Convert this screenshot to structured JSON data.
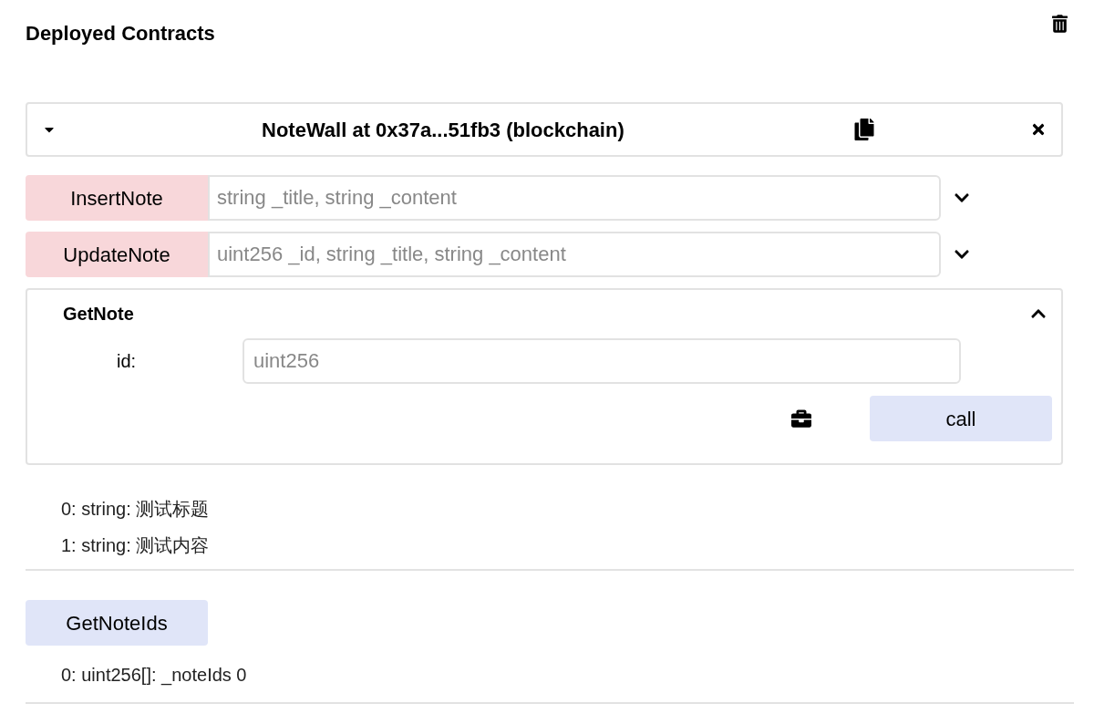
{
  "header": {
    "title": "Deployed Contracts"
  },
  "contract": {
    "title": "NoteWall at 0x37a...51fb3 (blockchain)",
    "expanded": true
  },
  "functions": [
    {
      "kind": "transact",
      "name": "InsertNote",
      "placeholder": "string _title, string _content",
      "expanded": false
    },
    {
      "kind": "transact",
      "name": "UpdateNote",
      "placeholder": "uint256 _id, string _title, string _content",
      "expanded": false
    },
    {
      "kind": "call",
      "name": "GetNote",
      "expanded": true,
      "params": [
        {
          "label": "id:",
          "placeholder": "uint256"
        }
      ],
      "action": "call",
      "results": [
        "0: string: 测试标题",
        "1: string: 测试内容"
      ]
    },
    {
      "kind": "call",
      "name": "GetNoteIds",
      "results": [
        "0: uint256[]: _noteIds 0"
      ]
    }
  ]
}
